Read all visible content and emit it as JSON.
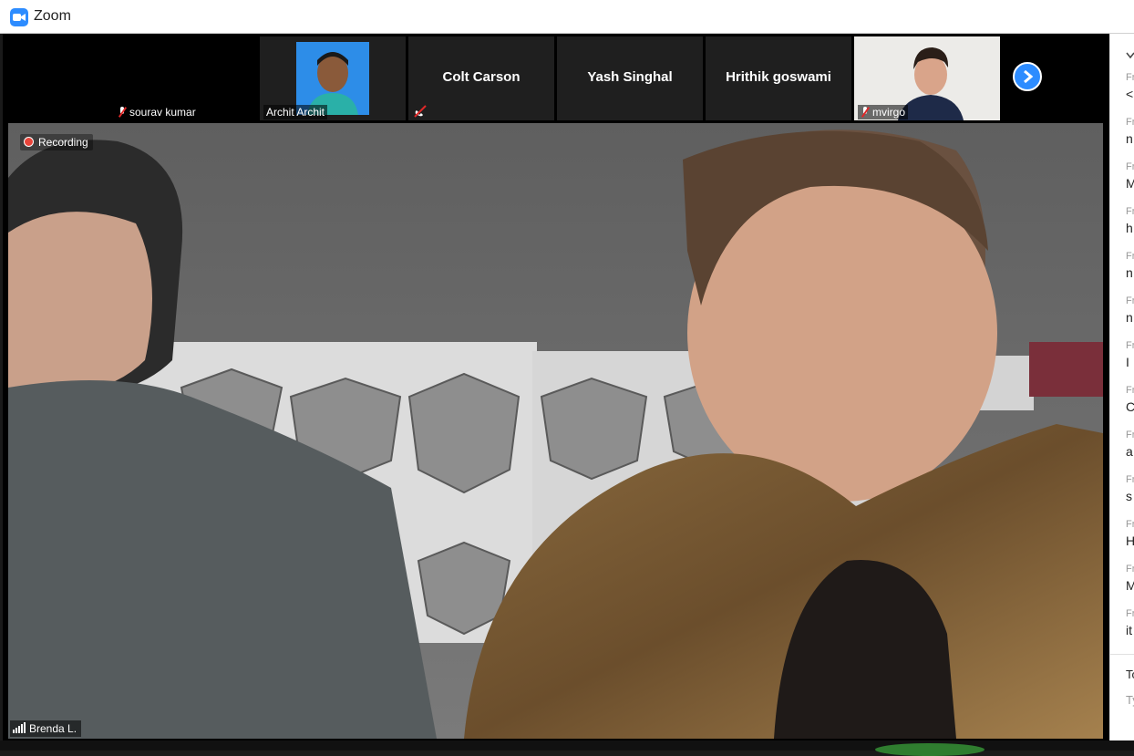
{
  "window": {
    "title": "Zoom"
  },
  "thumbnails": [
    {
      "name": "sourav kumar",
      "audio": "muted",
      "video": "off"
    },
    {
      "name": "Archit Archit",
      "audio": "on",
      "video": "on"
    },
    {
      "name": "Colt Carson",
      "audio": "phone-off",
      "video": "off"
    },
    {
      "name": "Yash Singhal",
      "audio": "on",
      "video": "off"
    },
    {
      "name": "Hrithik goswami",
      "audio": "on",
      "video": "off"
    },
    {
      "name": "mvirgo",
      "audio": "muted",
      "video": "on"
    }
  ],
  "active_speaker": {
    "name": "Brenda L.",
    "recording_label": "Recording"
  },
  "chat_panel": {
    "messages": [
      {
        "from": "Fr",
        "text": "<"
      },
      {
        "from": "Fr",
        "text": "n"
      },
      {
        "from": "Fr",
        "text": "M"
      },
      {
        "from": "Fr",
        "text": "h"
      },
      {
        "from": "Fr",
        "text": "n"
      },
      {
        "from": "Fr",
        "text": "n"
      },
      {
        "from": "Fr",
        "text": "I"
      },
      {
        "from": "Fr",
        "text": "C"
      },
      {
        "from": "Fr",
        "text": "a"
      },
      {
        "from": "Fr",
        "text": "s"
      },
      {
        "from": "Fr",
        "text": "H"
      },
      {
        "from": "Fr",
        "text": "M"
      },
      {
        "from": "Fr",
        "text": "it"
      }
    ],
    "to_label": "To",
    "input_placeholder": "Ty"
  },
  "colors": {
    "zoom_blue": "#2d8cff",
    "recording_red": "#e8443a",
    "muted_red": "#e02828"
  }
}
